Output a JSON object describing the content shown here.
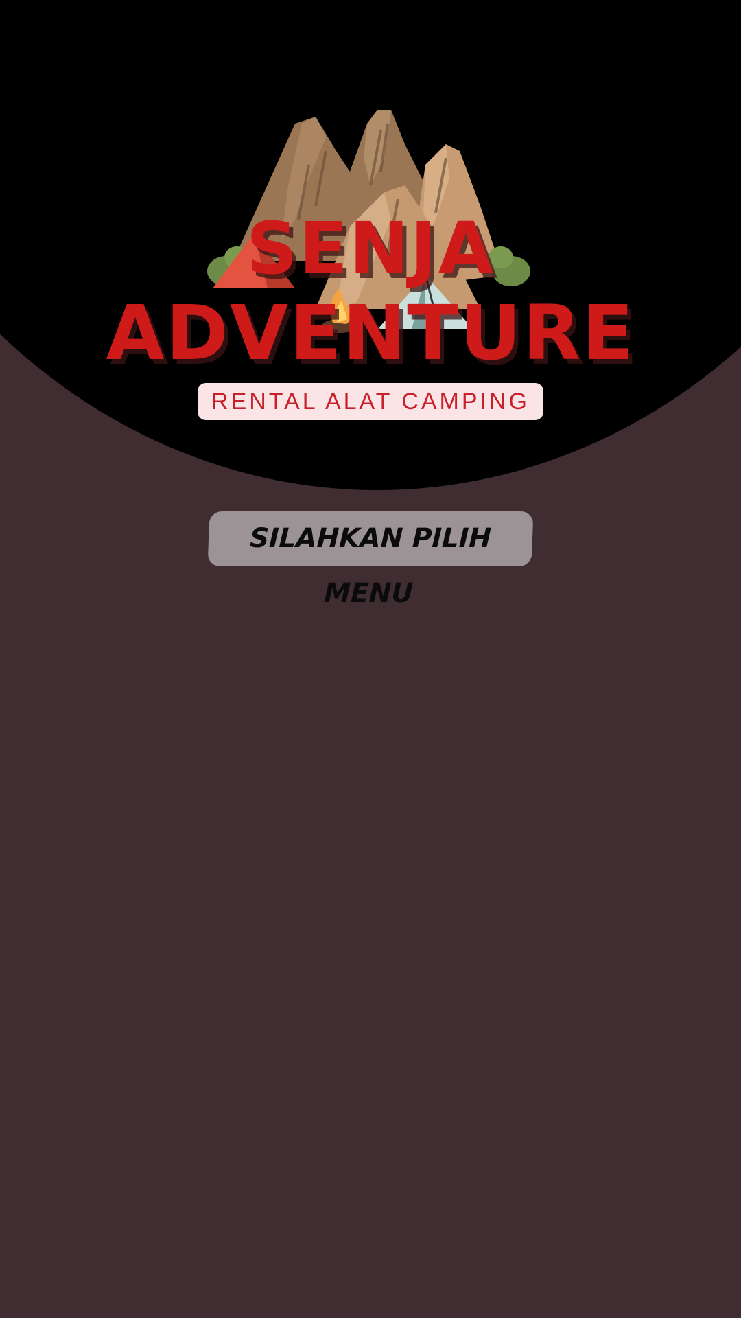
{
  "brand": {
    "line1": "SENJA",
    "line2": "ADVENTURE",
    "tagline": "RENTAL ALAT CAMPING"
  },
  "menu": {
    "prompt": "SILAHKAN PILIH MENU"
  },
  "colors": {
    "background": "#3f2d32",
    "header": "#000000",
    "brand_red": "#cf1a1a",
    "tagline_bg": "#fbe4e6",
    "prompt_bg": "#9c9396"
  },
  "icons": {
    "logo_illustration": "mountain-camp-icon"
  }
}
